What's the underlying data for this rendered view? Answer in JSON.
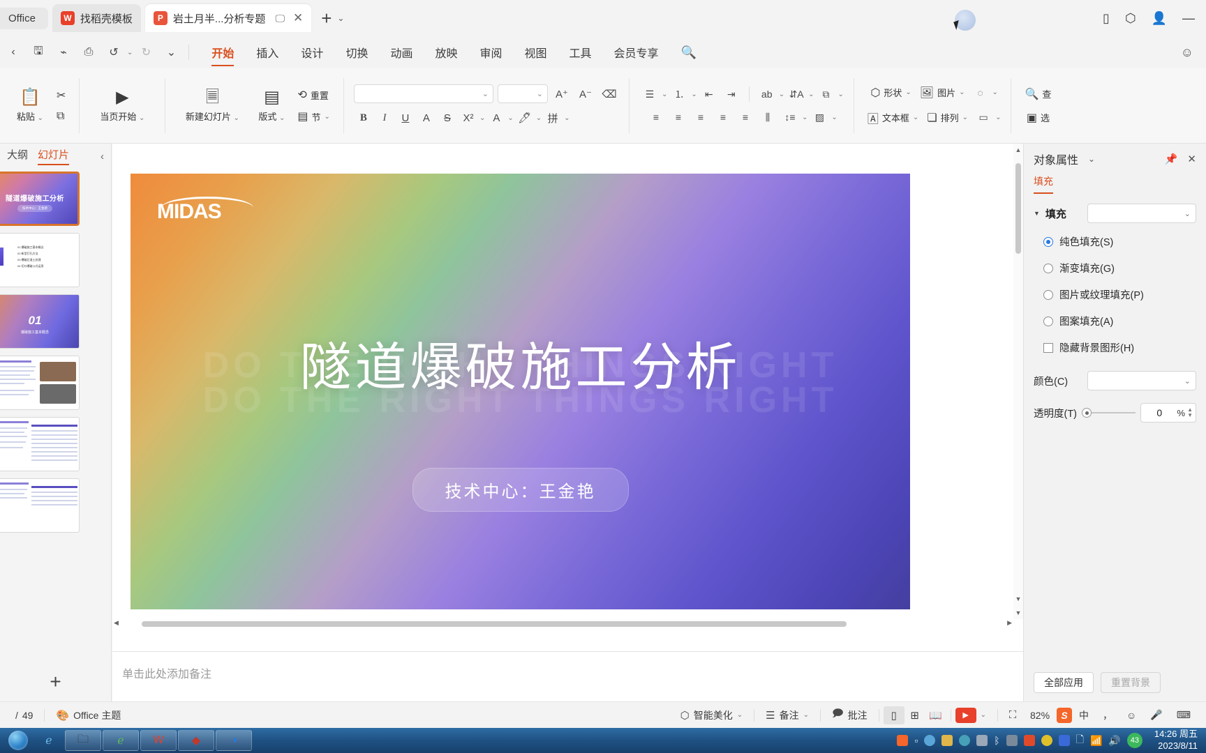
{
  "titlebar": {
    "office_label": "Office",
    "tabs": [
      {
        "label": "找稻壳模板",
        "icon": "wps-icon",
        "active": false
      },
      {
        "label": "岩土月半...分析专题",
        "icon": "ppt-icon",
        "active": true
      }
    ],
    "new_tab": "+",
    "caret": "⌄",
    "right_icons": [
      "sidebar-icon",
      "cube-icon",
      "avatar-icon",
      "minimize-icon"
    ],
    "minimize": "—"
  },
  "quick_access": {
    "items": [
      "chevron-left-icon",
      "save-icon",
      "format-painter-icon",
      "print-preview-icon",
      "undo-icon",
      "redo-icon",
      "customize-icon"
    ]
  },
  "menubar": {
    "items": [
      {
        "label": "开始",
        "active": true
      },
      {
        "label": "插入",
        "active": false
      },
      {
        "label": "设计",
        "active": false
      },
      {
        "label": "切换",
        "active": false
      },
      {
        "label": "动画",
        "active": false
      },
      {
        "label": "放映",
        "active": false
      },
      {
        "label": "审阅",
        "active": false
      },
      {
        "label": "视图",
        "active": false
      },
      {
        "label": "工具",
        "active": false
      },
      {
        "label": "会员专享",
        "active": false
      }
    ],
    "search_icon": "search-icon",
    "help_icon": "smiley-icon"
  },
  "ribbon": {
    "paste": {
      "label": "粘贴",
      "icon": "clipboard-icon"
    },
    "cut": {
      "label": "剪切",
      "icon": "scissors-icon"
    },
    "copy": {
      "label": "复制",
      "icon": "copy-icon"
    },
    "start_here": {
      "label": "当页开始",
      "icon": "play-circle-icon"
    },
    "new_slide": {
      "label": "新建幻灯片",
      "icon": "new-slide-icon"
    },
    "layout": {
      "label": "版式",
      "icon": "layout-icon"
    },
    "section": {
      "label": "节",
      "icon": "section-icon"
    },
    "reset": {
      "label": "重置",
      "icon": "reset-icon"
    },
    "font_name": "",
    "font_name_placeholder": "",
    "font_size": "",
    "grow_font": "A⁺",
    "shrink_font": "A⁻",
    "clear_format": "clear-format-icon",
    "bold": "B",
    "italic": "I",
    "underline": "U",
    "strike_through": "S",
    "text_effect": "A",
    "superscript": "X²",
    "font_color": "A",
    "highlight": "highlight-icon",
    "pinyin": "拼",
    "shapes": {
      "label": "形状",
      "icon": "shape-icon"
    },
    "picture": {
      "label": "图片",
      "icon": "picture-icon"
    },
    "textbox": {
      "label": "文本框",
      "icon": "textbox-icon"
    },
    "arrange": {
      "label": "排列",
      "icon": "arrange-icon"
    },
    "find": {
      "label": "查",
      "icon": "search-icon"
    },
    "select": {
      "label": "选",
      "icon": "select-icon"
    }
  },
  "left_pane": {
    "tabs": [
      {
        "label": "大纲",
        "active": false
      },
      {
        "label": "幻灯片",
        "active": true
      }
    ],
    "collapse_icon": "chevron-left-icon",
    "add_slide": "+",
    "thumbnails": [
      {
        "index": "1",
        "title": "隧道爆破施工分析",
        "subtitle": "技术中心：王金艳",
        "selected": true
      },
      {
        "index": "2",
        "items": [
          "01 爆破施工基本概念",
          "02 新型打孔方法",
          "03 爆破后渣土处理",
          "04 切口爆破公式运用"
        ],
        "selected": false
      },
      {
        "index": "3",
        "big": "01",
        "sub": "爆破施工基本概念",
        "selected": false
      },
      {
        "index": "4",
        "selected": false
      },
      {
        "index": "5",
        "selected": false
      },
      {
        "index": "6",
        "selected": false
      }
    ]
  },
  "slide": {
    "logo": "MIDAS",
    "watermark": "DO THE RIGHT THINGS RIGHT",
    "title": "隧道爆破施工分析",
    "subtitle": "技术中心：王金艳"
  },
  "notes": {
    "placeholder": "单击此处添加备注"
  },
  "right_panel": {
    "title": "对象属性",
    "title_caret": "⌄",
    "pin_icon": "pin-icon",
    "close_icon": "close-icon",
    "tab": "填充",
    "section_label": "填充",
    "section_caret": "▼",
    "fill_options": [
      {
        "label": "纯色填充(S)",
        "selected": true
      },
      {
        "label": "渐变填充(G)",
        "selected": false
      },
      {
        "label": "图片或纹理填充(P)",
        "selected": false
      },
      {
        "label": "图案填充(A)",
        "selected": false
      }
    ],
    "hide_bg_graphics": {
      "label": "隐藏背景图形(H)",
      "checked": false
    },
    "color_label": "颜色(C)",
    "transparency_label": "透明度(T)",
    "transparency_value": "0",
    "transparency_unit": "%",
    "apply_all": "全部应用",
    "reset_bg": "重置背景"
  },
  "statusbar": {
    "page_info": "49",
    "page_prefix": "/",
    "theme_icon": "theme-icon",
    "theme": "Office 主题",
    "beautify": {
      "label": "智能美化",
      "icon": "beautify-icon"
    },
    "notes_btn": {
      "label": "备注",
      "icon": "notes-icon"
    },
    "comment_btn": {
      "label": "批注",
      "icon": "comment-icon"
    },
    "views": [
      "normal-view-icon",
      "slide-sorter-icon",
      "reading-view-icon"
    ],
    "play_icon": "play-icon",
    "fit_icon": "fit-to-window-icon",
    "zoom": "82%",
    "ime": {
      "sogou": "S",
      "lang": "中",
      "comma": "，",
      "smiley": "☺",
      "mic": "mic-icon",
      "keyboard": "keyboard-icon"
    }
  },
  "taskbar": {
    "start": "start-orb-icon",
    "pinned": [
      "internet-explorer-icon",
      "file-explorer-icon",
      "browser-icon",
      "wps-writer-icon",
      "fx-icon",
      "edge-icon"
    ],
    "tray_icons": [
      "sogou-icon",
      "cloud-icon",
      "shield-icon",
      "sync-icon",
      "network-icon",
      "bluetooth-icon",
      "usb-icon",
      "cc-icon",
      "plus-icon",
      "sogou2-icon",
      "battery-icon",
      "signal-icon",
      "volume-icon"
    ],
    "battery_percent": "43",
    "time": "14:26 周五",
    "date": "2023/8/11"
  }
}
